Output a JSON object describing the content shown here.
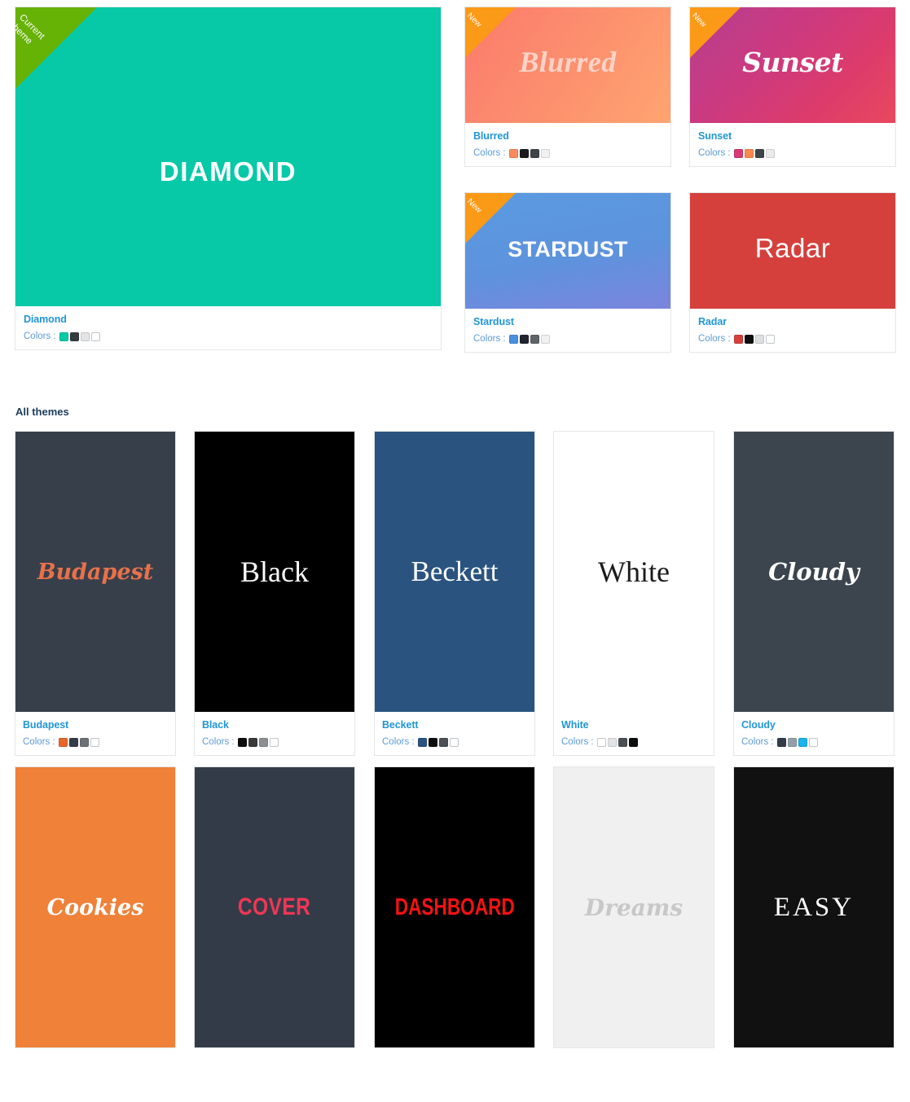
{
  "featured": {
    "cards": [
      {
        "id": "diamond",
        "name": "Diamond",
        "art_text": "DIAMOND",
        "badge": "Current theme",
        "badge_line1": "Current",
        "badge_line2": "theme",
        "badge_color": "#66b205",
        "colors_label": "Colors :",
        "swatches": [
          "#07c9a7",
          "#353a3f",
          "#e2e4e6",
          "#ffffff"
        ]
      },
      {
        "id": "blurred",
        "name": "Blurred",
        "art_text": "Blurred",
        "badge": "New",
        "badge_color": "#fb9a16",
        "colors_label": "Colors :",
        "swatches": [
          "#fb8a5e",
          "#1b1b1b",
          "#3f4448",
          "#f0f1f2"
        ]
      },
      {
        "id": "sunset",
        "name": "Sunset",
        "art_text": "Sunset",
        "badge": "New",
        "badge_color": "#fb9a16",
        "colors_label": "Colors :",
        "swatches": [
          "#d93a74",
          "#fb8a4e",
          "#3f4448",
          "#e8eaec"
        ]
      },
      {
        "id": "stardust",
        "name": "Stardust",
        "art_text": "STARDUST",
        "badge": "New",
        "badge_color": "#fb9a16",
        "colors_label": "Colors :",
        "swatches": [
          "#4a90e2",
          "#1f242e",
          "#5e6468",
          "#eef0f1"
        ]
      },
      {
        "id": "radar",
        "name": "Radar",
        "art_text": "Radar",
        "badge": null,
        "badge_color": null,
        "colors_label": "Colors :",
        "swatches": [
          "#d5403c",
          "#0d0d0d",
          "#dcdfe1",
          "#ffffff"
        ]
      }
    ]
  },
  "all_themes": {
    "heading": "All themes",
    "colors_label": "Colors :",
    "items": [
      {
        "id": "budapest",
        "name": "Budapest",
        "art_text": "Budapest",
        "bg": "#373f4a",
        "swatches": [
          "#e8662a",
          "#343c48",
          "#6b7176",
          "#ffffff"
        ]
      },
      {
        "id": "black",
        "name": "Black",
        "art_text": "Black",
        "bg": "#000000",
        "swatches": [
          "#0d0d0d",
          "#38393b",
          "#8c8f92",
          "#ffffff"
        ]
      },
      {
        "id": "beckett",
        "name": "Beckett",
        "art_text": "Beckett",
        "bg": "#2a547f",
        "swatches": [
          "#2a547f",
          "#0d0d0d",
          "#4a5055",
          "#ffffff"
        ]
      },
      {
        "id": "white",
        "name": "White",
        "art_text": "White",
        "bg": "#ffffff",
        "swatches": [
          "#ffffff",
          "#e2e4e6",
          "#4a5055",
          "#0d0d0d"
        ]
      },
      {
        "id": "cloudy",
        "name": "Cloudy",
        "art_text": "Cloudy",
        "bg": "#3c444e",
        "swatches": [
          "#343c48",
          "#94a0a9",
          "#1bb4ec",
          "#ffffff"
        ]
      },
      {
        "id": "cookies",
        "name": "Cookies",
        "art_text": "Cookies",
        "bg": "#ef8139",
        "swatches": []
      },
      {
        "id": "cover",
        "name": "COVER",
        "art_text": "COVER",
        "bg": "#343b48",
        "swatches": []
      },
      {
        "id": "dashboard",
        "name": "DASHBOARD",
        "art_text": "DASHBOARD",
        "bg": "#000000",
        "swatches": []
      },
      {
        "id": "dreams",
        "name": "Dreams",
        "art_text": "Dreams",
        "bg": "#f0f0f0",
        "swatches": []
      },
      {
        "id": "easy",
        "name": "EASY",
        "art_text": "EASY",
        "bg": "#111111",
        "swatches": []
      }
    ]
  }
}
